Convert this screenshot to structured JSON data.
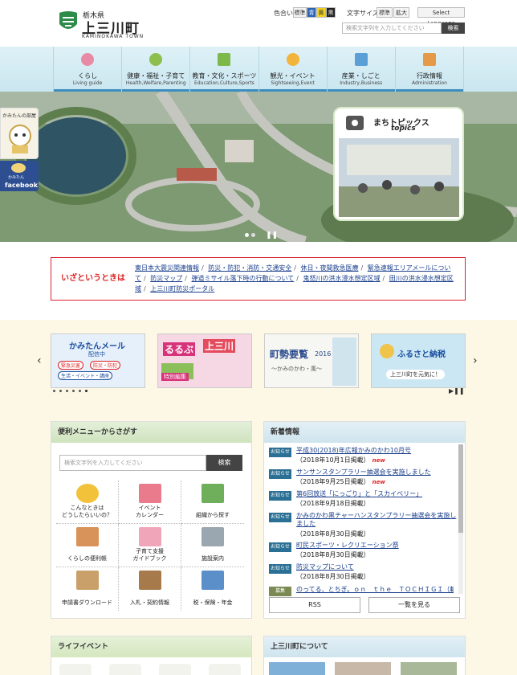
{
  "header": {
    "pref": "栃木県",
    "town": "上三川町",
    "town_en": "KAMINOKAWA TOWN",
    "color_label": "色合い",
    "color_options": [
      "標準",
      "青",
      "黄",
      "黒"
    ],
    "fontsize_label": "文字サイズ",
    "fontsize_options": [
      "標準",
      "拡大"
    ],
    "language": "Select Language",
    "search_placeholder": "検索文字列を入力してください",
    "search_button": "検索"
  },
  "nav": [
    {
      "jp": "くらし",
      "en": "Living guide",
      "color": "#e88aa3"
    },
    {
      "jp": "健康・福祉・子育て",
      "en": "Health,Welfare,Parenting",
      "color": "#8cbf4d"
    },
    {
      "jp": "教育・文化・スポーツ",
      "en": "Education,Culture,Sports",
      "color": "#7cb94a"
    },
    {
      "jp": "観光・イベント",
      "en": "Sightseeing,Event",
      "color": "#f2b43a"
    },
    {
      "jp": "産業・しごと",
      "en": "Industry,Business",
      "color": "#5aa0d6"
    },
    {
      "jp": "行政情報",
      "en": "Administration",
      "color": "#e59a4a"
    }
  ],
  "hero": {
    "side_tab1": "かみたんの部屋",
    "side_tab2_small": "かみたん",
    "side_tab2": "facebook",
    "topics_jp": "まちトピックス",
    "topics_en": "topics"
  },
  "alert": {
    "title": "いざというときは",
    "links": [
      "東日本大震災関連情報",
      "防災・防犯・消防・交通安全",
      "休日・夜間救急医療",
      "緊急速報エリアメールについて",
      "防災マップ",
      "弾道ミサイル落下時の行動について",
      "鬼怒川の洪水浸水想定区域",
      "田川の洪水浸水想定区域",
      "上三川町防災ポータル"
    ]
  },
  "banners": {
    "mail_title": "かみたんメール",
    "mail_sub": "配信中",
    "mail_tags": [
      "緊急災害",
      "防災・防犯",
      "生活・イベント・講座"
    ],
    "rurubu_tag": "特別編集",
    "rurubu_logo": "るるぶ",
    "rurubu_town": "上三川",
    "youran_title": "町勢要覧",
    "youran_year": "2016",
    "youran_sub": "〜かみのかわ・風〜",
    "furusato_title": "ふるさと納税",
    "furusato_sub": "上三川町を元気に！"
  },
  "convenience": {
    "title": "便利メニューからさがす",
    "search_placeholder": "検索文字列を入力してください",
    "search_button": "検索",
    "items": [
      {
        "label": "こんなときは\nどうしたらいいの？",
        "color": "#f2c23a"
      },
      {
        "label": "イベント\nカレンダー",
        "color": "#e97b8c"
      },
      {
        "label": "組織から探す",
        "color": "#6fae5b"
      },
      {
        "label": "くらしの便利帳",
        "color": "#d8935a"
      },
      {
        "label": "子育て支援\nガイドブック",
        "color": "#f0a6b8"
      },
      {
        "label": "施設案内",
        "color": "#9aa6b0"
      },
      {
        "label": "申請書ダウンロード",
        "color": "#c9a06a"
      },
      {
        "label": "入札・契約情報",
        "color": "#a67a4a"
      },
      {
        "label": "税・保険・年金",
        "color": "#5a8fc9"
      }
    ]
  },
  "news": {
    "title": "新着情報",
    "items": [
      {
        "badge": "お知らせ",
        "title": "平成30(2018)年広報かみのかわ10月号",
        "date": "（2018年10月1日掲載）",
        "new": "new"
      },
      {
        "badge": "お知らせ",
        "title": "サンサンスタンプラリー抽選会を実施しました",
        "date": "（2018年9月25日掲載）",
        "new": "new"
      },
      {
        "badge": "お知らせ",
        "title": "第6回放送「にっごり」と「スカイベリー」",
        "date": "（2018年9月18日掲載）",
        "new": ""
      },
      {
        "badge": "お知らせ",
        "title": "かみのかわ黒チャーハンスタンプラリー抽選会を実施しました",
        "date": "（2018年8月30日掲載）",
        "new": ""
      },
      {
        "badge": "お知らせ",
        "title": "町民スポーツ・レクリエーション祭",
        "date": "（2018年8月30日掲載）",
        "new": ""
      },
      {
        "badge": "お知らせ",
        "title": "防災マップについて",
        "date": "（2018年8月30日掲載）",
        "new": ""
      },
      {
        "badge": "募集",
        "title": "のってる、とちぎ。ｏｎ　ｔｈｅ　ＴＯＣＨＩＧＩ（載",
        "date": "",
        "new": ""
      }
    ],
    "rss": "RSS",
    "list_button": "一覧を見る"
  },
  "life": {
    "title": "ライフイベント"
  },
  "about": {
    "title": "上三川町について"
  }
}
